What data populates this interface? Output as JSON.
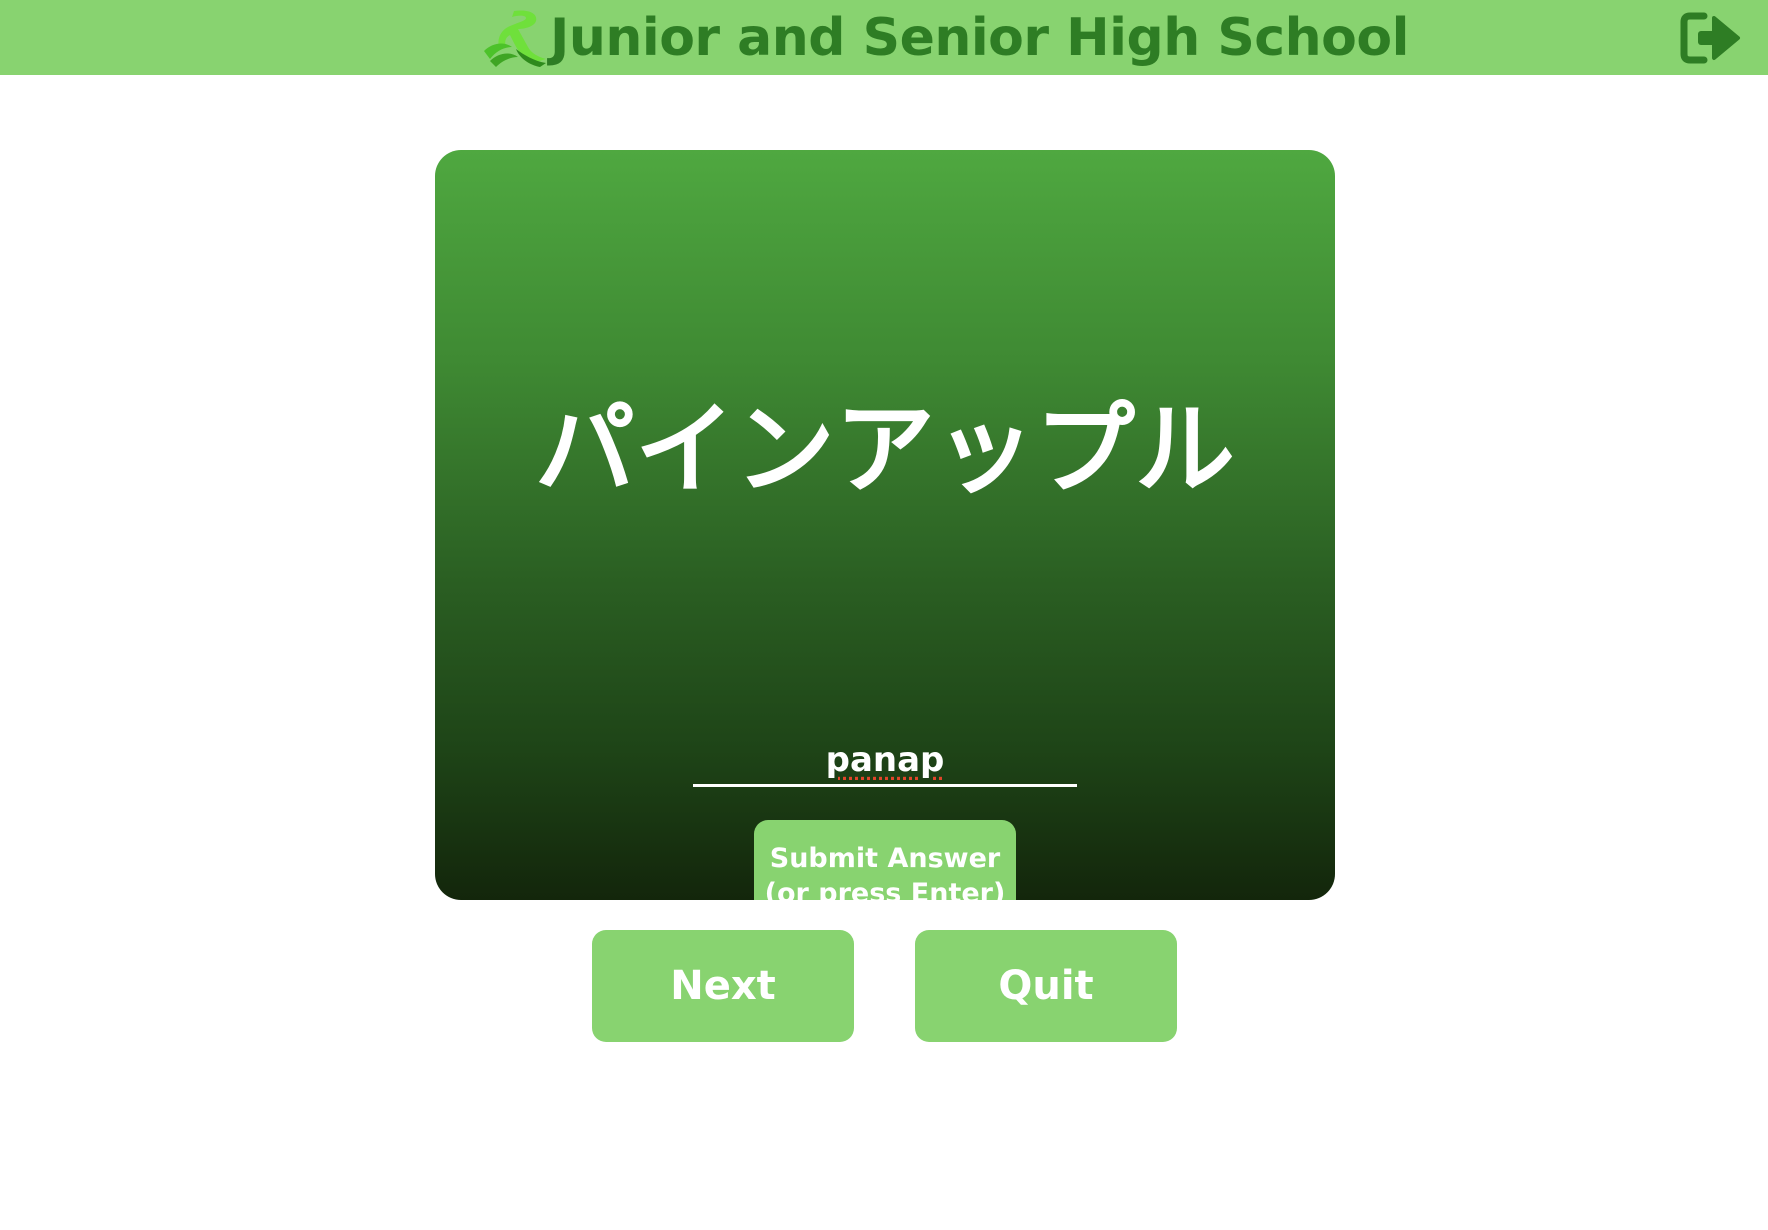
{
  "header": {
    "title": "Junior and Senior High School",
    "logo_icon": "school-crest-logo",
    "logout_icon": "sign-out-icon"
  },
  "quiz": {
    "prompt_word": "パインアップル",
    "answer_value": "panap",
    "submit_label": "Submit Answer (or press Enter)"
  },
  "controls": {
    "next_label": "Next",
    "quit_label": "Quit"
  },
  "colors": {
    "header_bg": "#88d370",
    "title_color": "#2e7d24",
    "card_top": "#4fa840",
    "card_bottom": "#13260b",
    "button_bg": "#88d370"
  }
}
